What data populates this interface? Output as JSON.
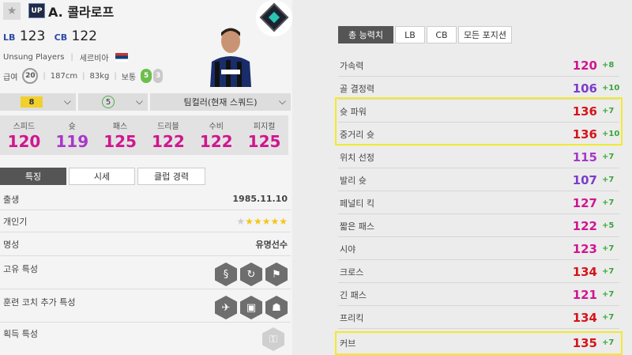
{
  "player": {
    "name": "A. 콜라로프",
    "season_badge": "UP",
    "positions": [
      {
        "pos": "LB",
        "ovr": "123"
      },
      {
        "pos": "CB",
        "ovr": "122"
      }
    ],
    "team": "Unsung Players",
    "nation": "세르비아",
    "pay": "20",
    "height": "187cm",
    "weight": "83kg",
    "body": "보통",
    "skill_left": "5",
    "skill_right": "3"
  },
  "selectors": {
    "level": "8",
    "skill": "5",
    "teamcolor": "팀컬러(현재 스쿼드)"
  },
  "main_stats": [
    {
      "label": "스피드",
      "value": "120",
      "color": "#d01690"
    },
    {
      "label": "슛",
      "value": "119",
      "color": "#a838c9"
    },
    {
      "label": "패스",
      "value": "125",
      "color": "#d01690"
    },
    {
      "label": "드리블",
      "value": "122",
      "color": "#d01690"
    },
    {
      "label": "수비",
      "value": "122",
      "color": "#d01690"
    },
    {
      "label": "피지컬",
      "value": "125",
      "color": "#d01690"
    }
  ],
  "left_tabs": [
    "특징",
    "시세",
    "클럽 경력"
  ],
  "info": {
    "birth_label": "출생",
    "birth": "1985.11.10",
    "pop_label": "개인기",
    "fame_label": "명성",
    "fame": "유명선수",
    "trait_label": "고유 특성",
    "coach_label": "훈련 코치 추가 특성",
    "acq_label": "획득 특성"
  },
  "right_tabs": [
    "총 능력치",
    "LB",
    "CB",
    "모든 포지션"
  ],
  "stat_rows": [
    {
      "label": "가속력",
      "value": "120",
      "bonus": "+8",
      "color": "#d01690"
    },
    {
      "label": "골 결정력",
      "value": "106",
      "bonus": "+10",
      "color": "#7b3ec9"
    },
    {
      "label": "슛 파워",
      "value": "136",
      "bonus": "+7",
      "color": "#d4161c"
    },
    {
      "label": "중거리 슛",
      "value": "136",
      "bonus": "+10",
      "color": "#d4161c"
    },
    {
      "label": "위치 선정",
      "value": "115",
      "bonus": "+7",
      "color": "#a838c9"
    },
    {
      "label": "발리 슛",
      "value": "107",
      "bonus": "+7",
      "color": "#7b3ec9"
    },
    {
      "label": "페널티 킥",
      "value": "127",
      "bonus": "+7",
      "color": "#d01690"
    },
    {
      "label": "짧은 패스",
      "value": "122",
      "bonus": "+5",
      "color": "#d01690"
    },
    {
      "label": "시야",
      "value": "123",
      "bonus": "+7",
      "color": "#d01690"
    },
    {
      "label": "크로스",
      "value": "134",
      "bonus": "+7",
      "color": "#d4161c"
    },
    {
      "label": "긴 패스",
      "value": "121",
      "bonus": "+7",
      "color": "#d01690"
    },
    {
      "label": "프리킥",
      "value": "134",
      "bonus": "+7",
      "color": "#d4161c"
    },
    {
      "label": "커브",
      "value": "135",
      "bonus": "+7",
      "color": "#d4161c"
    }
  ]
}
